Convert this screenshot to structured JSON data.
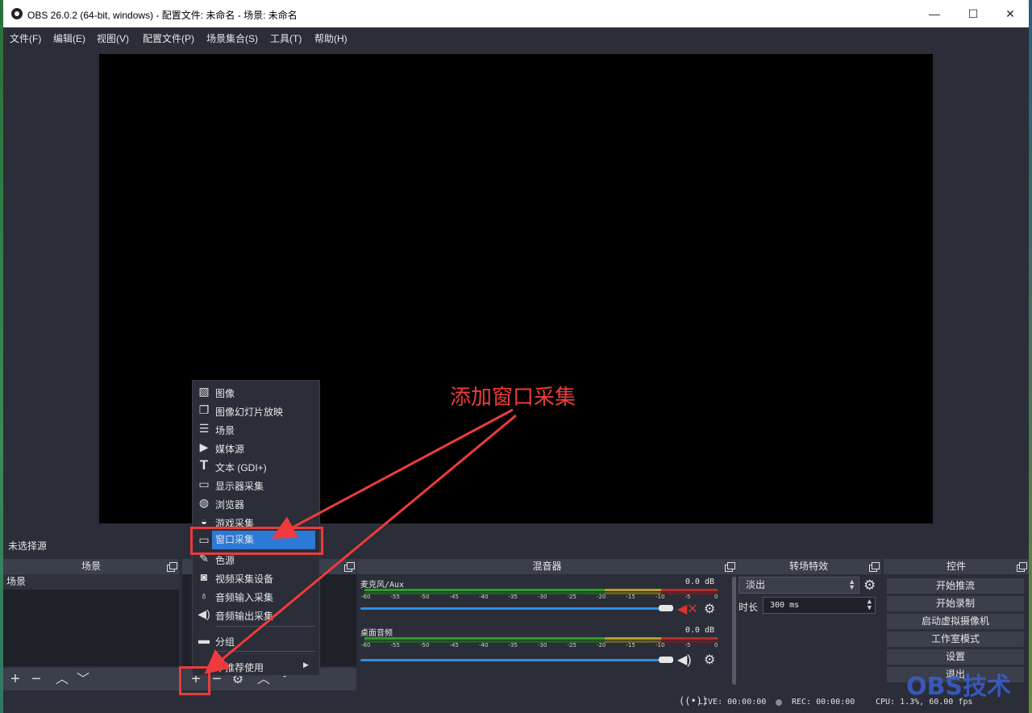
{
  "window": {
    "title": "OBS 26.0.2 (64-bit, windows) - 配置文件: 未命名 - 场景: 未命名"
  },
  "titlebar_buttons": {
    "minimize": "—",
    "maximize": "☐",
    "close": "✕"
  },
  "menubar": [
    "文件(F)",
    "编辑(E)",
    "视图(V)",
    "配置文件(P)",
    "场景集合(S)",
    "工具(T)",
    "帮助(H)"
  ],
  "source_status": "未选择源",
  "docks": {
    "scenes": {
      "title": "场景",
      "items": [
        "场景"
      ]
    },
    "sources": {
      "title": ""
    },
    "mixer": {
      "title": "混音器",
      "tracks": [
        {
          "name": "麦克风/Aux",
          "db": "0.0 dB",
          "muted": true
        },
        {
          "name": "桌面音频",
          "db": "0.0 dB",
          "muted": false
        }
      ],
      "ticks": [
        "-60",
        "-55",
        "-50",
        "-45",
        "-40",
        "-35",
        "-30",
        "-25",
        "-20",
        "-15",
        "-10",
        "-5",
        "0"
      ]
    },
    "transitions": {
      "title": "转场特效",
      "selected": "淡出",
      "duration_label": "时长",
      "duration_value": "300 ms"
    },
    "controls": {
      "title": "控件",
      "buttons": [
        "开始推流",
        "开始录制",
        "启动虚拟摄像机",
        "工作室模式",
        "设置",
        "退出"
      ]
    }
  },
  "context_menu": {
    "items": [
      "图像",
      "图像幻灯片放映",
      "场景",
      "媒体源",
      "文本 (GDI+)",
      "显示器采集",
      "浏览器",
      "游戏采集",
      "窗口采集",
      "色源",
      "视频采集设备",
      "音频输入采集",
      "音频输出采集"
    ],
    "group": "分组",
    "deprecated": "不推荐使用",
    "selected_index": 8
  },
  "annotation": {
    "text": "添加窗口采集"
  },
  "statusbar": {
    "live": "LIVE: 00:00:00",
    "rec": "REC: 00:00:00",
    "cpu": "CPU: 1.3%, 60.00 fps"
  },
  "watermark": "OBS技术"
}
